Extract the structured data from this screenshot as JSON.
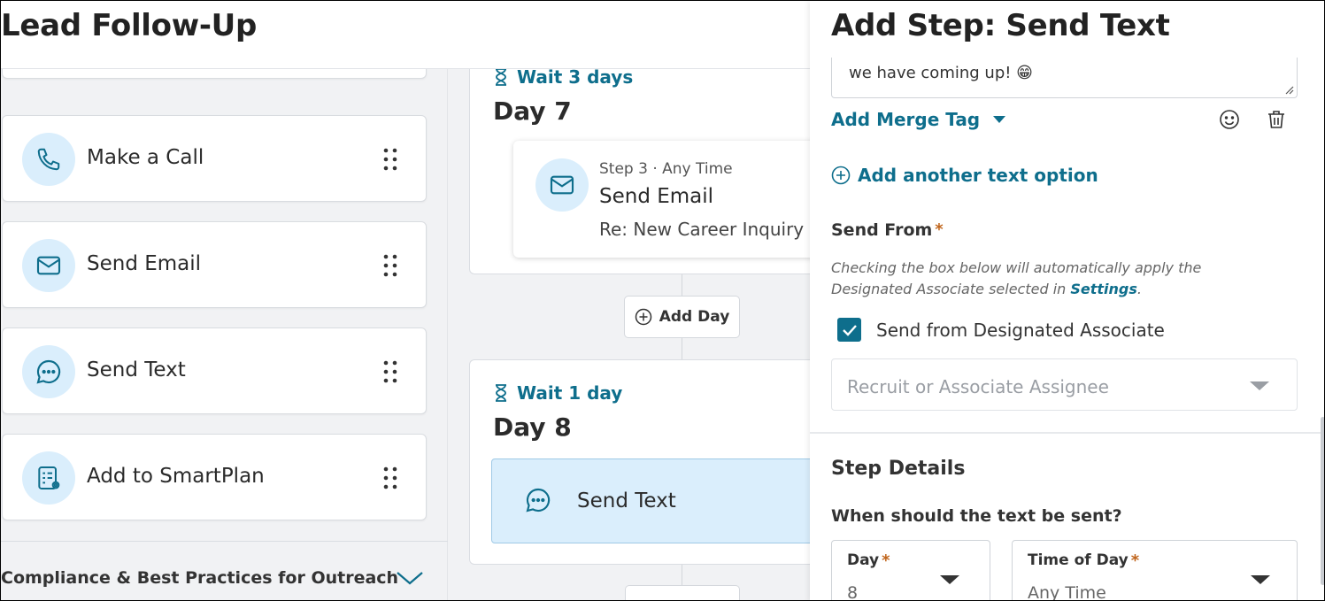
{
  "header": {
    "title": "Lead Follow-Up"
  },
  "actions": [
    {
      "label": "Make a Call",
      "icon": "phone-icon"
    },
    {
      "label": "Send Email",
      "icon": "mail-icon"
    },
    {
      "label": "Send Text",
      "icon": "chat-icon"
    },
    {
      "label": "Add to SmartPlan",
      "icon": "smartplan-icon"
    }
  ],
  "compliance": {
    "label": "Compliance & Best Practices for Outreach"
  },
  "timeline": {
    "day7": {
      "wait": "Wait 3 days",
      "title": "Day 7",
      "step": {
        "meta": "Step 3 · Any Time",
        "title": "Send Email",
        "subtitle": "Re: New Career Inquiry"
      }
    },
    "add_day": "Add Day",
    "day8": {
      "wait": "Wait 1 day",
      "title": "Day 8",
      "step": {
        "title": "Send Text"
      }
    }
  },
  "panel": {
    "title": "Add Step: Send Text",
    "message_tail": "we have coming up! 😁",
    "merge_tag": "Add Merge Tag",
    "add_option": "Add another text option",
    "send_from_label": "Send From",
    "required_mark": "*",
    "help_text": "Checking the box below will automatically apply the Designated Associate selected in ",
    "help_link": "Settings",
    "help_end": ".",
    "checkbox_label": "Send from Designated Associate",
    "checkbox_checked": true,
    "assignee_placeholder": "Recruit or Associate Assignee",
    "step_details": "Step Details",
    "when_label": "When should the text be sent?",
    "day_field": {
      "label": "Day",
      "value": "8"
    },
    "time_field": {
      "label": "Time of Day",
      "value": "Any Time"
    }
  },
  "colors": {
    "accent": "#0e6e8c",
    "icon_bg": "#daeefc",
    "required": "#c0651c"
  }
}
